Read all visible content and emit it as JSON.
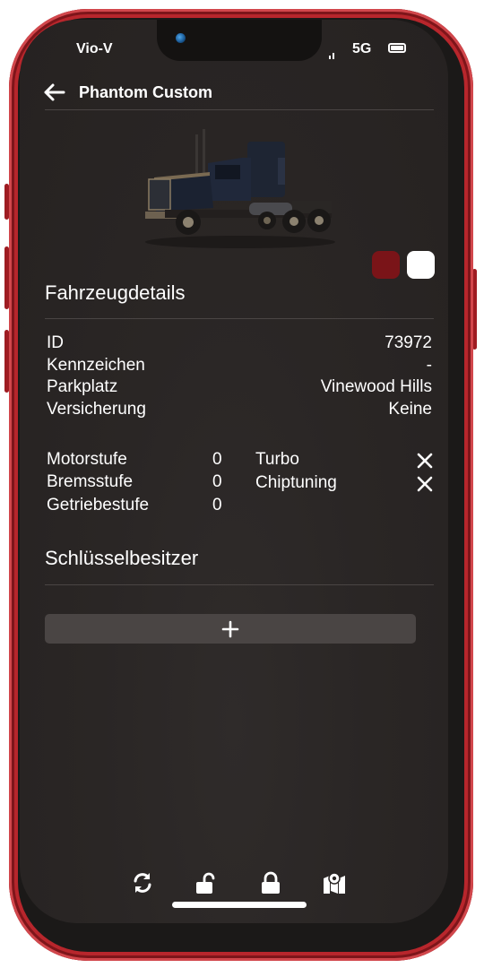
{
  "status_bar": {
    "carrier": "Vio-V",
    "network": "5G"
  },
  "header": {
    "title": "Phantom Custom"
  },
  "vehicle": {
    "image_icon": "truck-image",
    "colors": {
      "primary": "#7a1418",
      "secondary": "#ffffff"
    }
  },
  "details": {
    "title": "Fahrzeugdetails",
    "rows": [
      {
        "label": "ID",
        "value": "73972"
      },
      {
        "label": "Kennzeichen",
        "value": "-"
      },
      {
        "label": "Parkplatz",
        "value": "Vinewood Hills"
      },
      {
        "label": "Versicherung",
        "value": "Keine"
      }
    ]
  },
  "tuning": {
    "levels": [
      {
        "label": "Motorstufe",
        "value": "0"
      },
      {
        "label": "Bremsstufe",
        "value": "0"
      },
      {
        "label": "Getriebestufe",
        "value": "0"
      }
    ],
    "features": [
      {
        "label": "Turbo",
        "icon": "x-icon"
      },
      {
        "label": "Chiptuning",
        "icon": "x-icon"
      }
    ]
  },
  "key_owners": {
    "title": "Schlüsselbesitzer",
    "add_icon": "plus-icon"
  },
  "dock": {
    "icons": [
      "refresh-icon",
      "unlock-icon",
      "lock-icon",
      "map-marker-icon"
    ]
  }
}
